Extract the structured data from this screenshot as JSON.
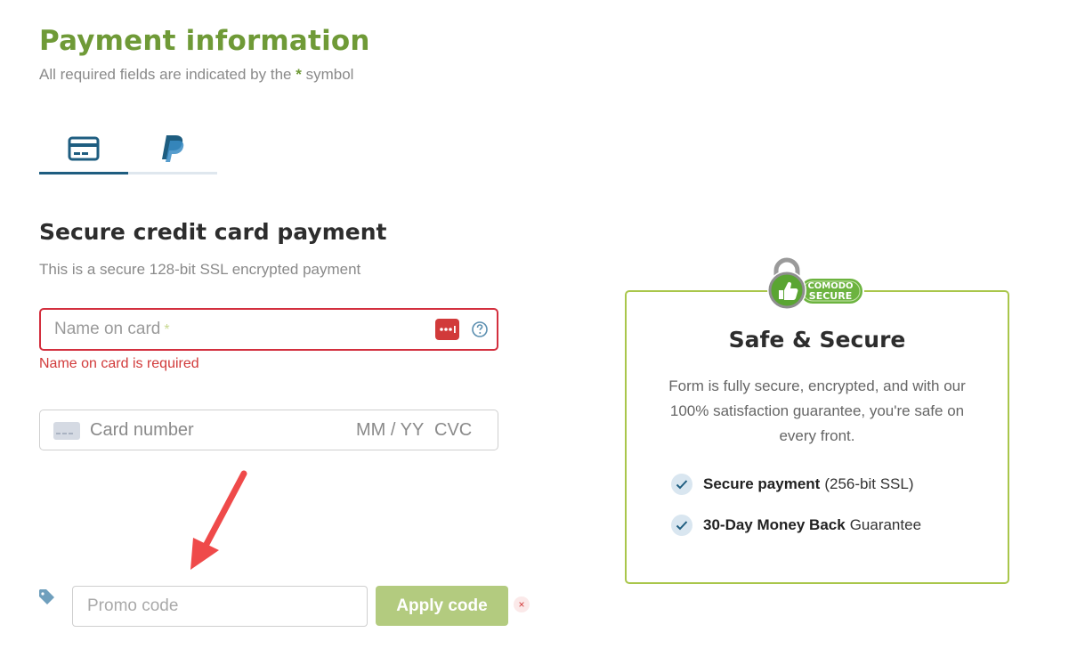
{
  "header": {
    "title": "Payment information",
    "required_note_pre": "All required fields are indicated by the",
    "required_star": "*",
    "required_note_post": "symbol"
  },
  "tabs": [
    {
      "label": "Credit card",
      "icon": "credit-card-icon",
      "active": true
    },
    {
      "label": "PayPal",
      "icon": "paypal-icon",
      "active": false
    }
  ],
  "section": {
    "title": "Secure credit card payment",
    "subtitle": "This is a secure 128-bit SSL encrypted payment"
  },
  "form": {
    "name_placeholder": "Name on card",
    "name_required_mark": "*",
    "name_error": "Name on card is required",
    "card_number_placeholder": "Card number",
    "expiry_placeholder": "MM / YY",
    "cvc_placeholder": "CVC"
  },
  "promo": {
    "placeholder": "Promo code",
    "apply_label": "Apply code",
    "remove_label": "×"
  },
  "secure_box": {
    "badge_brand": "COMODO",
    "badge_text": "SECURE",
    "title": "Safe & Secure",
    "text": "Form is fully secure, encrypted, and with our 100% satisfaction guarantee, you're safe on every front.",
    "features": [
      {
        "bold": "Secure payment",
        "rest": "(256-bit SSL)"
      },
      {
        "bold": "30-Day Money Back",
        "rest": "Guarantee"
      }
    ]
  },
  "colors": {
    "brand_green": "#6f9a37",
    "error_red": "#d32f3e",
    "tab_active": "#1e5d80",
    "apply_button": "#b3cb7f",
    "box_border": "#a9c64b"
  }
}
